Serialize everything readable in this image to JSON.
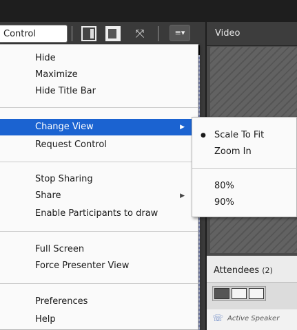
{
  "toolbar": {
    "control_label": "Control",
    "icons": [
      "layout-sidebar-icon",
      "layout-fill-icon",
      "fullscreen-arrows-icon",
      "pod-options-icon"
    ]
  },
  "video_pod": {
    "title": "Video"
  },
  "attendees_pod": {
    "title": "Attendees",
    "count": "(2)",
    "active_speaker_text": "Active Speaker"
  },
  "menu": {
    "items": [
      {
        "label": "Hide"
      },
      {
        "label": "Maximize"
      },
      {
        "label": "Hide Title Bar"
      },
      {
        "label": "Change View",
        "submenu": true,
        "selected": true
      },
      {
        "label": "Request Control"
      },
      {
        "label": "Stop Sharing"
      },
      {
        "label": "Share",
        "submenu": true
      },
      {
        "label": "Enable Participants to draw"
      },
      {
        "label": "Full Screen"
      },
      {
        "label": "Force Presenter View"
      },
      {
        "label": "Preferences"
      },
      {
        "label": "Help"
      }
    ]
  },
  "submenu": {
    "items": [
      {
        "label": "Scale To Fit",
        "checked": true
      },
      {
        "label": "Zoom In"
      },
      {
        "label": "80%"
      },
      {
        "label": "90%"
      }
    ]
  },
  "colors": {
    "selection": "#1b63d1",
    "menu_bg": "#fafafa",
    "app_bg": "#1e1e1e"
  }
}
